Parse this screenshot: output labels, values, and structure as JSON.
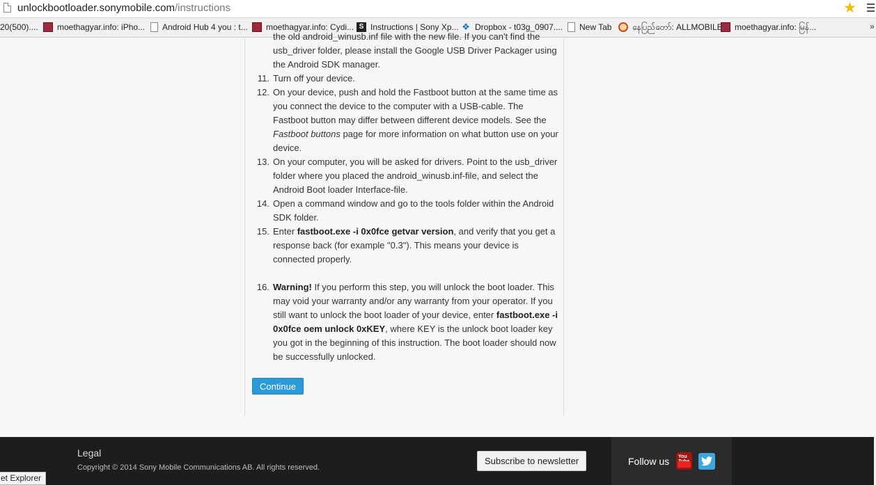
{
  "browser": {
    "url_host": "unlockbootloader.sonymobile.com",
    "url_path": "/instructions",
    "bookmarks": [
      "20(500)....",
      "moethagyar.info: iPho...",
      "Android Hub 4 you : t...",
      "moethagyar.info: Cydi...",
      "Instructions | Sony Xp...",
      "Dropbox - t03g_0907....",
      "New Tab",
      "နေပြည်တော်: ALLMOBILE",
      "moethagyar.info: မြန်..."
    ],
    "bookmarks_more": "»",
    "star_icon": "★"
  },
  "steps": {
    "partial_top": "the old android_winusb.inf file with the new file. If you can't find the usb_driver folder, please install the Google USB Driver Packager using the Android SDK manager.",
    "partial_top_line1": "the old android_winusb.inf file with the new file. If you can't find the",
    "partial_top_line2": "usb_driver folder, please install the Google USB Driver Packager using",
    "partial_top_line3": "the Android SDK manager.",
    "s11_num": "11.",
    "s11": "Turn off your device.",
    "s12_num": "12.",
    "s12_a": "On your device, push and hold the Fastboot button at the same time as you connect the device to the computer with a USB-cable. The Fastboot button may differ between different device models. See the ",
    "s12_em": "Fastboot buttons",
    "s12_b": " page for more information on what button use on your device.",
    "s13_num": "13.",
    "s13": "On your computer, you will be asked for drivers. Point to the usb_driver folder where you placed the android_winusb.inf-file, and select the Android Boot loader Interface-file.",
    "s14_num": "14.",
    "s14": "Open a command window and go to the tools folder within the Android SDK folder.",
    "s15_num": "15.",
    "s15_a": "Enter ",
    "s15_cmd": "fastboot.exe -i 0x0fce getvar version",
    "s15_b": ", and verify that you get a response back (for example \"0.3\"). This means your device is connected properly.",
    "s16_num": "16.",
    "s16_warn": "Warning!",
    "s16_a": " If you perform this step, you will unlock the boot loader. This may void your warranty and/or any warranty from your operator. If you still want to unlock the boot loader of your device, enter ",
    "s16_cmd": "fastboot.exe -i 0x0fce oem unlock 0xKEY",
    "s16_b": ", where KEY is the unlock boot loader key you got in the beginning of this instruction. The boot loader should now be successfully unlocked."
  },
  "continue_label": "Continue",
  "footer": {
    "legal": "Legal",
    "copyright": "Copyright © 2014 Sony Mobile Communications AB. All rights reserved.",
    "subscribe": "Subscribe to newsletter",
    "follow": "Follow us",
    "youtube_text": "You Tube"
  },
  "status_text": "et Explorer",
  "colors": {
    "accent": "#2c9ad6",
    "footer_bg": "#1d1d1d",
    "star": "#f2b90c"
  }
}
